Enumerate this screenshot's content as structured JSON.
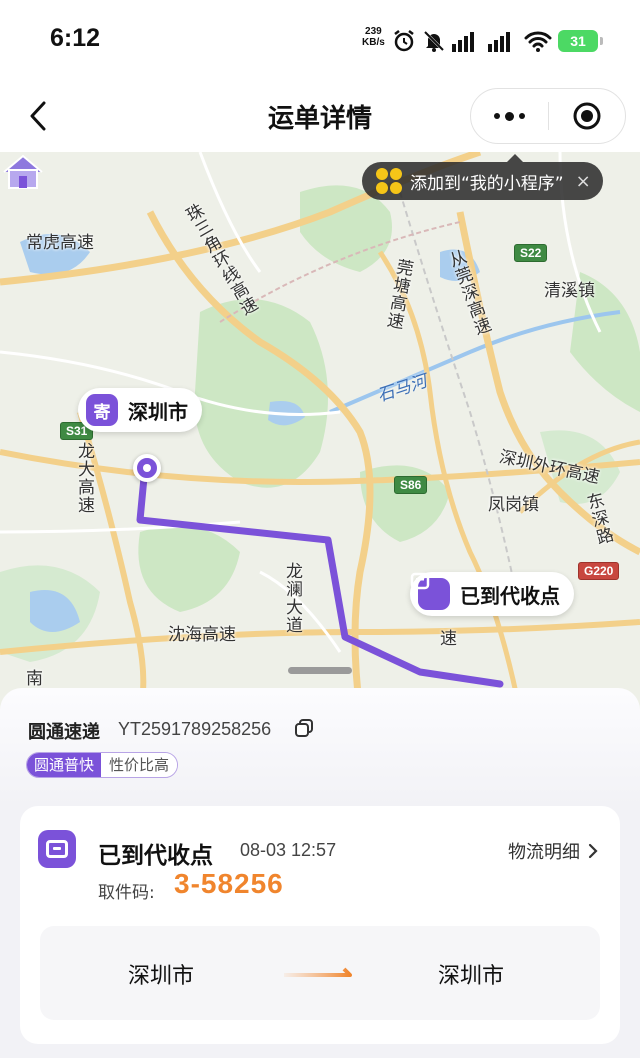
{
  "status_bar": {
    "time": "6:12",
    "net_speed_value": "239",
    "net_speed_unit": "KB/s",
    "battery": "31"
  },
  "nav": {
    "title": "运单详情"
  },
  "map": {
    "tip_text": "添加到“我的小程序”",
    "tip_close": "×",
    "labels": {
      "changhu": "常虎高速",
      "zhusanjiao": "珠三角环线高速",
      "longda": "龙大高速",
      "longlan": "龙澜大道",
      "yanhai": "沈海高速",
      "shimahe": "石马河",
      "huangshi": "从莞深高速",
      "guanshen": "莞塘高速",
      "qingxi": "清溪镇",
      "waihuan": "深圳外环高速",
      "fenggang": "凤岗镇",
      "dongshen": "东深路",
      "nan": "南",
      "su": "速"
    },
    "highways": {
      "s22": "S22",
      "s31": "S31",
      "s86": "S86",
      "g220": "G220"
    },
    "origin_badge": "寄",
    "origin_city": "深圳市",
    "dest_status": "已到代收点"
  },
  "shipment": {
    "carrier": "圆通速递",
    "tracking_no": "YT2591789258256",
    "tag_service": "圆通普快",
    "tag_value": "性价比高",
    "status": "已到代收点",
    "status_time": "08-03 12:57",
    "detail_link": "物流明细",
    "pickup_label": "取件码:",
    "pickup_code": "3-58256",
    "from_city": "深圳市",
    "to_city": "深圳市"
  },
  "colors": {
    "accent": "#7b52d9",
    "pickup_code": "#f0852d",
    "route_line": "#7b52d9"
  }
}
